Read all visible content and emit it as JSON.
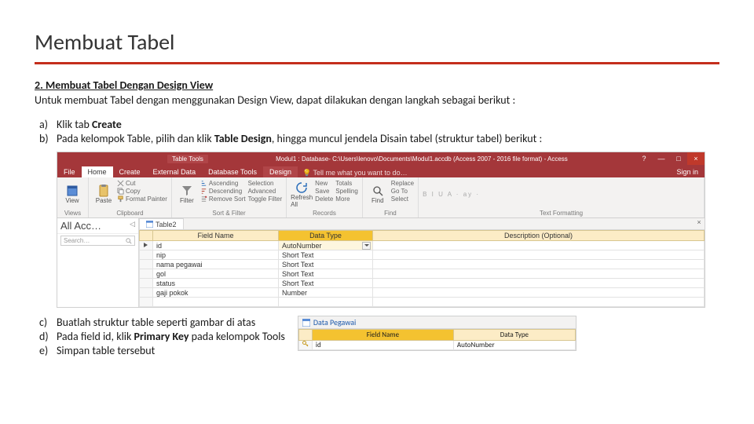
{
  "title": "Membuat Tabel",
  "subheading": "2. Membuat Tabel Dengan Design View",
  "lead": "Untuk membuat Tabel dengan menggunakan Design View, dapat dilakukan dengan langkah sebagai berikut :",
  "steps_ab": [
    {
      "label": "a)",
      "text_prefix": "Klik tab ",
      "bold": "Create",
      "text_suffix": ""
    },
    {
      "label": "b)",
      "text_prefix": "Pada kelompok Table, pilih dan klik ",
      "bold": "Table Design",
      "text_suffix": ", hingga muncul jendela Disain tabel (struktur tabel) berikut :"
    }
  ],
  "steps_cde": [
    {
      "label": "c)",
      "text_prefix": "Buatlah struktur table seperti gambar di atas",
      "bold": "",
      "text_suffix": ""
    },
    {
      "label": "d)",
      "text_prefix": "Pada field id, klik ",
      "bold": "Primary Key",
      "text_suffix": " pada kelompok Tools"
    },
    {
      "label": "e)",
      "text_prefix": "Simpan table tersebut",
      "bold": "",
      "text_suffix": ""
    }
  ],
  "access": {
    "table_tools": "Table Tools",
    "window_title": "Modul1 : Database- C:\\Users\\lenovo\\Documents\\Modul1.accdb (Access 2007 - 2016 file format) - Access",
    "tabs": [
      "File",
      "Home",
      "Create",
      "External Data",
      "Database Tools",
      "Design"
    ],
    "active_tab": "Home",
    "context_tab": "Design",
    "tell": "Tell me what you want to do…",
    "signin": "Sign in",
    "ribbon": {
      "views": {
        "btn": "View",
        "cap": "Views"
      },
      "clipboard": {
        "btn": "Paste",
        "cut": "Cut",
        "copy": "Copy",
        "fmt": "Format Painter",
        "cap": "Clipboard"
      },
      "sortfilter": {
        "btn": "Filter",
        "asc": "Ascending",
        "desc": "Descending",
        "rem": "Remove Sort",
        "sel": "Selection",
        "adv": "Advanced",
        "tog": "Toggle Filter",
        "cap": "Sort & Filter"
      },
      "records": {
        "btn": "Refresh All",
        "new": "New",
        "save": "Save",
        "del": "Delete",
        "tot": "Totals",
        "spl": "Spelling",
        "more": "More",
        "cap": "Records"
      },
      "find": {
        "btn": "Find",
        "rep": "Replace",
        "goto": "Go To",
        "sel": "Select",
        "cap": "Find"
      },
      "textfmt": {
        "labels": "B  I  U   A · ay ·",
        "cap": "Text Formatting"
      }
    },
    "nav": {
      "title": "All Acc…",
      "search": "Search…"
    },
    "doc_tab": "Table2",
    "datasheet": {
      "headers": [
        "Field Name",
        "Data Type",
        "Description (Optional)"
      ],
      "selected_header_index": 1,
      "rows": [
        {
          "name": "id",
          "type": "AutoNumber",
          "selected": true
        },
        {
          "name": "nip",
          "type": "Short Text",
          "selected": false
        },
        {
          "name": "nama pegawai",
          "type": "Short Text",
          "selected": false
        },
        {
          "name": "gol",
          "type": "Short Text",
          "selected": false
        },
        {
          "name": "status",
          "type": "Short Text",
          "selected": false
        },
        {
          "name": "gaji pokok",
          "type": "Number",
          "selected": false
        }
      ]
    }
  },
  "mini": {
    "tab": "Data Pegawai",
    "headers": [
      "Field Name",
      "Data Type"
    ],
    "selected_header_index": 0,
    "row": {
      "name": "id",
      "type": "AutoNumber"
    }
  }
}
